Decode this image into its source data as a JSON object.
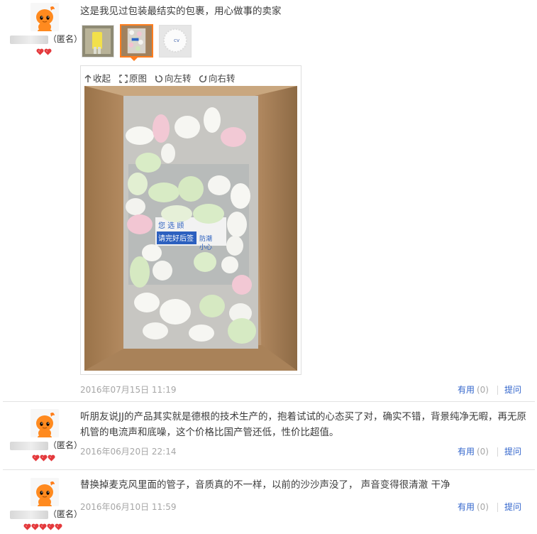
{
  "colors": {
    "accent_orange": "#ff7d1e",
    "link_blue": "#3366cc",
    "muted_gray": "#a6a6a6",
    "heart_red": "#e4393c"
  },
  "reviews": [
    {
      "user_suffix": "（匿名）",
      "hearts": 2,
      "text": "这是我见过包装最结实的包裹，用心做事的卖家",
      "date": "2016年07月15日 11:19",
      "useful_label": "有用",
      "useful_count": "(0)",
      "reply_label": "提问",
      "images": [
        "thumbnail-yellow-item",
        "thumbnail-packing-box",
        "thumbnail-white-fluffy"
      ],
      "selected_image": 1
    },
    {
      "user_suffix": "（匿名）",
      "hearts": 3,
      "text": "听朋友说JJ的产品其实就是德根的技术生产的，抱着试试的心态买了对，确实不错，背景纯净无暇，再无原机管的电流声和底噪，这个价格比国产管还低，性价比超值。",
      "date": "2016年06月20日 22:14",
      "useful_label": "有用",
      "useful_count": "(0)",
      "reply_label": "提问"
    },
    {
      "user_suffix": "（匿名）",
      "hearts": 5,
      "text": "替换掉麦克风里面的管子，音质真的不一样，以前的沙沙声没了， 声音变得很清澈 干净",
      "date": "2016年06月10日 11:59",
      "useful_label": "有用",
      "useful_count": "(0)",
      "reply_label": "提问"
    }
  ],
  "viewer": {
    "collapse_label": "收起",
    "original_label": "原图",
    "rotate_left_label": "向左转",
    "rotate_right_label": "向右转",
    "photo_label_line1": "您 选 顾",
    "photo_label_line2": "请完好后签",
    "photo_label_line3": "防潮",
    "photo_label_line4": "小心"
  }
}
